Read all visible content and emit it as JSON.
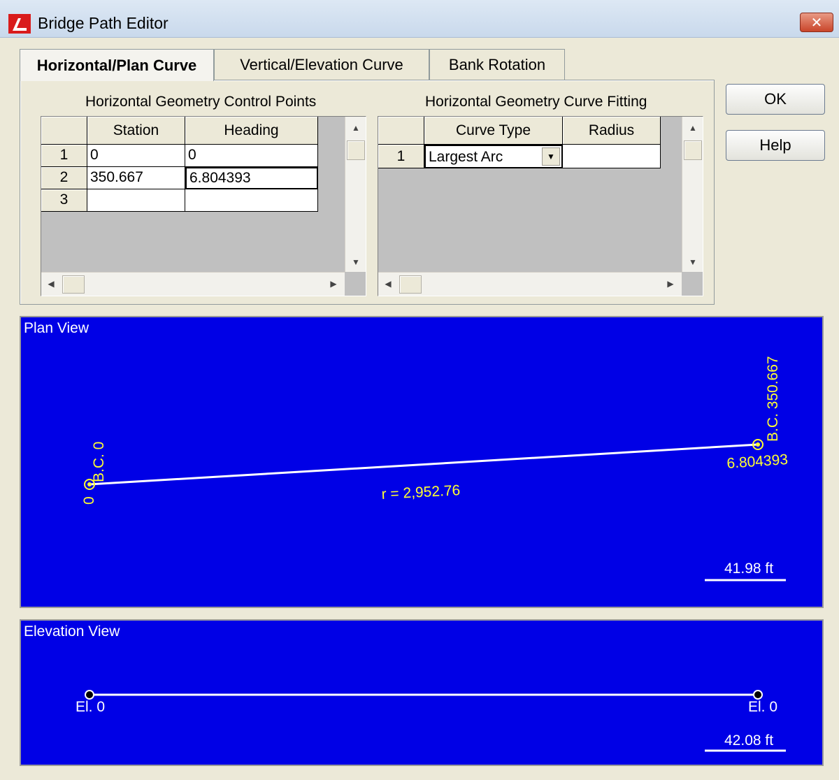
{
  "window": {
    "title": "Bridge Path Editor",
    "close_label": "✕"
  },
  "tabs": [
    {
      "label": "Horizontal/Plan Curve",
      "active": true
    },
    {
      "label": "Vertical/Elevation Curve",
      "active": false
    },
    {
      "label": "Bank Rotation",
      "active": false
    }
  ],
  "control_points": {
    "title": "Horizontal Geometry Control Points",
    "columns": [
      "Station",
      "Heading"
    ],
    "rows": [
      {
        "num": "1",
        "station": "0",
        "heading": "0"
      },
      {
        "num": "2",
        "station": "350.667",
        "heading": "6.804393"
      },
      {
        "num": "3",
        "station": "",
        "heading": ""
      }
    ]
  },
  "curve_fitting": {
    "title": "Horizontal Geometry Curve Fitting",
    "columns": [
      "Curve Type",
      "Radius"
    ],
    "rows": [
      {
        "num": "1",
        "curve_type": "Largest Arc",
        "radius": ""
      }
    ]
  },
  "buttons": {
    "ok": "OK",
    "help": "Help"
  },
  "plan_view": {
    "label": "Plan View",
    "start_label": "B.C. 0",
    "start_sub": "0",
    "end_label": "B.C. 350.667",
    "end_sub": "6.804393",
    "radius_label": "r = 2,952.76",
    "scale_label": "41.98 ft"
  },
  "elevation_view": {
    "label": "Elevation View",
    "start_label": "El. 0",
    "end_label": "El. 0",
    "scale_label": "42.08 ft"
  },
  "colors": {
    "view_bg": "#0000e6",
    "annotation": "#ffff33",
    "path": "#ffffff"
  }
}
